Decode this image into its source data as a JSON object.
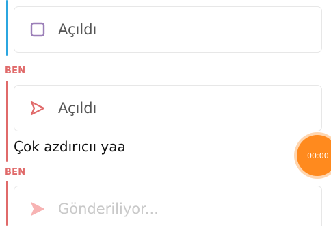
{
  "messages": [
    {
      "status_label": "Açıldı",
      "status_icon": "square-outline-icon"
    },
    {
      "sender": "BEN",
      "status_label": "Açıldı",
      "status_icon": "send-arrow-outline-icon"
    },
    {
      "text": "Çok azdırıcıı yaa"
    },
    {
      "sender": "BEN",
      "status_label": "Gönderiliyor...",
      "status_icon": "send-arrow-filled-icon"
    }
  ],
  "timer": {
    "label": "00:00"
  },
  "colors": {
    "received_thread": "#2ba6e0",
    "sent_thread": "#e06a6a",
    "opened_square": "#9b7fb8",
    "sent_arrow": "#e06a6a",
    "sending_arrow": "#f7b3b3",
    "timer": "#ff8a1e"
  }
}
